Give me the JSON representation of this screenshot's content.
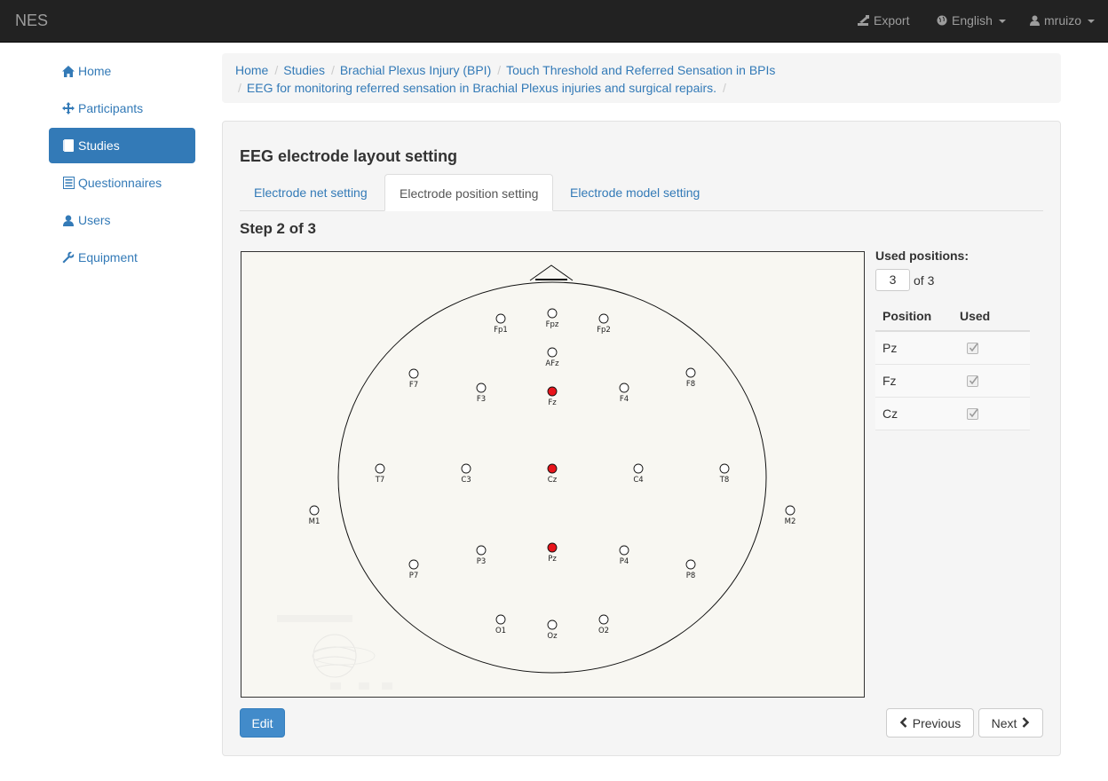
{
  "navbar": {
    "brand": "NES",
    "export_label": "Export",
    "language_label": "English",
    "user_label": "mruizo"
  },
  "sidebar": {
    "items": [
      {
        "label": "Home",
        "icon": "home-icon"
      },
      {
        "label": "Participants",
        "icon": "move-icon"
      },
      {
        "label": "Studies",
        "icon": "book-icon",
        "active": true
      },
      {
        "label": "Questionnaires",
        "icon": "list-icon"
      },
      {
        "label": "Users",
        "icon": "user-icon"
      },
      {
        "label": "Equipment",
        "icon": "wrench-icon"
      }
    ]
  },
  "breadcrumb": [
    "Home",
    "Studies",
    "Brachial Plexus Injury (BPI)",
    "Touch Threshold and Referred Sensation in BPIs",
    "EEG for monitoring referred sensation in Brachial Plexus injuries and surgical repairs."
  ],
  "main": {
    "title": "EEG electrode layout setting",
    "tabs": [
      {
        "label": "Electrode net setting"
      },
      {
        "label": "Electrode position setting",
        "active": true
      },
      {
        "label": "Electrode model setting"
      }
    ],
    "step": "Step 2 of 3",
    "used_positions_label": "Used positions:",
    "used_positions_value": "3",
    "used_positions_total": "of 3",
    "table": {
      "headers": [
        "Position",
        "Used"
      ],
      "rows": [
        {
          "position": "Pz",
          "used": true
        },
        {
          "position": "Fz",
          "used": true
        },
        {
          "position": "Cz",
          "used": true
        }
      ]
    },
    "buttons": {
      "edit": "Edit",
      "previous": "Previous",
      "next": "Next"
    }
  },
  "electrode_map": {
    "electrodes": [
      {
        "name": "Fp1",
        "used": false
      },
      {
        "name": "Fpz",
        "used": false
      },
      {
        "name": "Fp2",
        "used": false
      },
      {
        "name": "AFz",
        "used": false
      },
      {
        "name": "F7",
        "used": false
      },
      {
        "name": "F3",
        "used": false
      },
      {
        "name": "Fz",
        "used": true
      },
      {
        "name": "F4",
        "used": false
      },
      {
        "name": "F8",
        "used": false
      },
      {
        "name": "T7",
        "used": false
      },
      {
        "name": "C3",
        "used": false
      },
      {
        "name": "Cz",
        "used": true
      },
      {
        "name": "C4",
        "used": false
      },
      {
        "name": "T8",
        "used": false
      },
      {
        "name": "M1",
        "used": false
      },
      {
        "name": "M2",
        "used": false
      },
      {
        "name": "P7",
        "used": false
      },
      {
        "name": "P3",
        "used": false
      },
      {
        "name": "Pz",
        "used": true
      },
      {
        "name": "P4",
        "used": false
      },
      {
        "name": "P8",
        "used": false
      },
      {
        "name": "O1",
        "used": false
      },
      {
        "name": "Oz",
        "used": false
      },
      {
        "name": "O2",
        "used": false
      }
    ],
    "used_color": "#e8141b",
    "unused_color": "#ffffff"
  }
}
